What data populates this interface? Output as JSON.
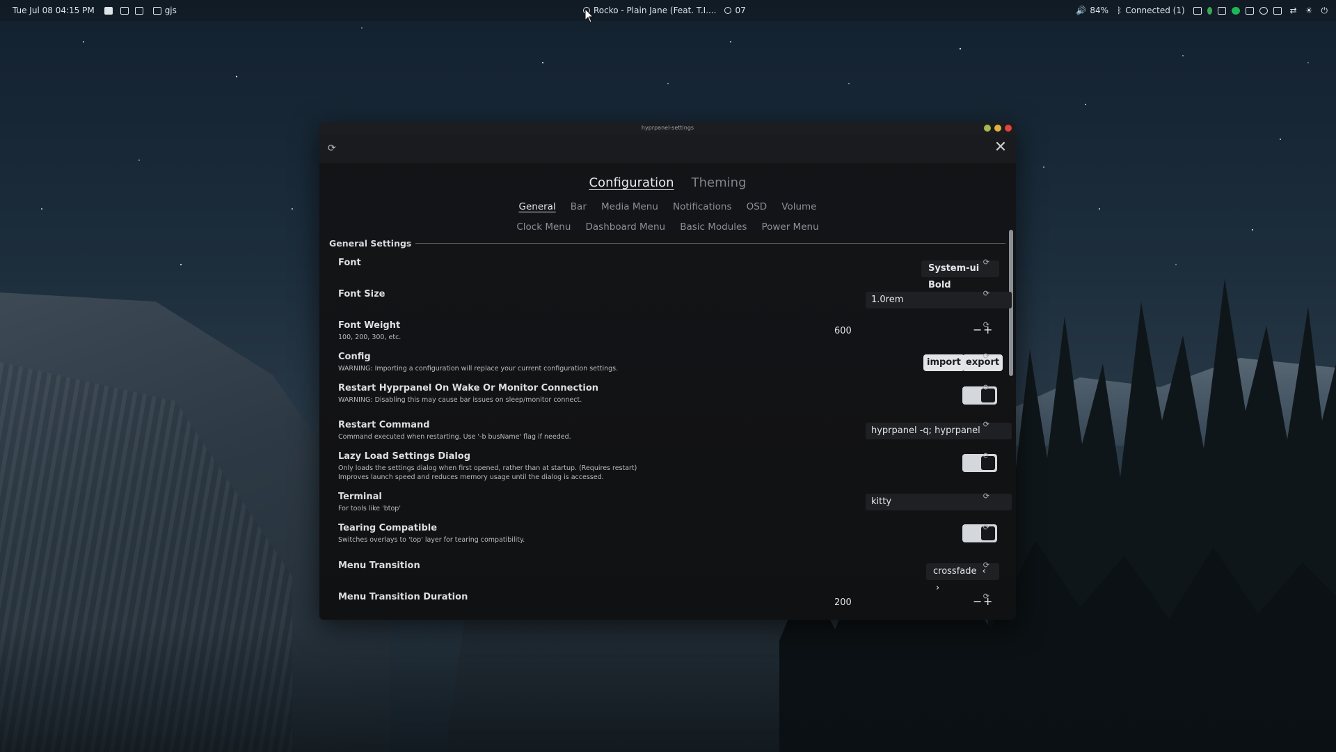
{
  "topbar": {
    "datetime": "Tue Jul 08  04:15 PM",
    "workspace_label": "gjs",
    "media_title": "Rocko - Plain Jane (Feat. T.I....",
    "update_count": "07",
    "volume": "84%",
    "bluetooth": "Connected (1)"
  },
  "window": {
    "title": "hyprpanel-settings",
    "close_glyph": "✕",
    "refresh_glyph": "⟳",
    "controls": {
      "min_color": "#a8b84a",
      "max_color": "#e0b13c",
      "close_color": "#e0443e"
    }
  },
  "tabs": {
    "main": [
      {
        "label": "Configuration",
        "active": true
      },
      {
        "label": "Theming",
        "active": false
      }
    ],
    "sub_row1": [
      {
        "label": "General",
        "active": true
      },
      {
        "label": "Bar",
        "active": false
      },
      {
        "label": "Media Menu",
        "active": false
      },
      {
        "label": "Notifications",
        "active": false
      },
      {
        "label": "OSD",
        "active": false
      },
      {
        "label": "Volume",
        "active": false
      }
    ],
    "sub_row2": [
      {
        "label": "Clock Menu"
      },
      {
        "label": "Dashboard Menu"
      },
      {
        "label": "Basic Modules"
      },
      {
        "label": "Power Menu"
      }
    ]
  },
  "section": {
    "title": "General Settings"
  },
  "settings": {
    "font": {
      "title": "Font",
      "value": "System-ui Bold"
    },
    "font_size": {
      "title": "Font Size",
      "value": "1.0rem"
    },
    "font_weight": {
      "title": "Font Weight",
      "subtitle": "100, 200, 300, etc.",
      "value": "600"
    },
    "config": {
      "title": "Config",
      "subtitle": "WARNING: Importing a configuration will replace your current configuration settings.",
      "import_label": "import",
      "export_label": "export"
    },
    "restart_wake": {
      "title": "Restart Hyprpanel On Wake Or Monitor Connection",
      "subtitle": "WARNING: Disabling this may cause bar issues on sleep/monitor connect.",
      "enabled": true
    },
    "restart_command": {
      "title": "Restart Command",
      "subtitle": "Command executed when restarting. Use '-b busName' flag if needed.",
      "value": "hyprpanel -q; hyprpanel"
    },
    "lazy_load": {
      "title": "Lazy Load Settings Dialog",
      "subtitle_1": "Only loads the settings dialog when first opened, rather than at startup. (Requires restart)",
      "subtitle_2": "Improves launch speed and reduces memory usage until the dialog is accessed.",
      "enabled": true
    },
    "terminal": {
      "title": "Terminal",
      "subtitle": "For tools like 'btop'",
      "value": "kitty"
    },
    "tearing": {
      "title": "Tearing Compatible",
      "subtitle": "Switches overlays to 'top' layer for tearing compatibility.",
      "enabled": true
    },
    "menu_transition": {
      "title": "Menu Transition",
      "value": "crossfade"
    },
    "menu_transition_duration": {
      "title": "Menu Transition Duration",
      "value": "200"
    }
  },
  "glyphs": {
    "reset": "⟳",
    "minus": "−",
    "plus": "+",
    "arrow_left": "‹",
    "arrow_right": "›"
  }
}
